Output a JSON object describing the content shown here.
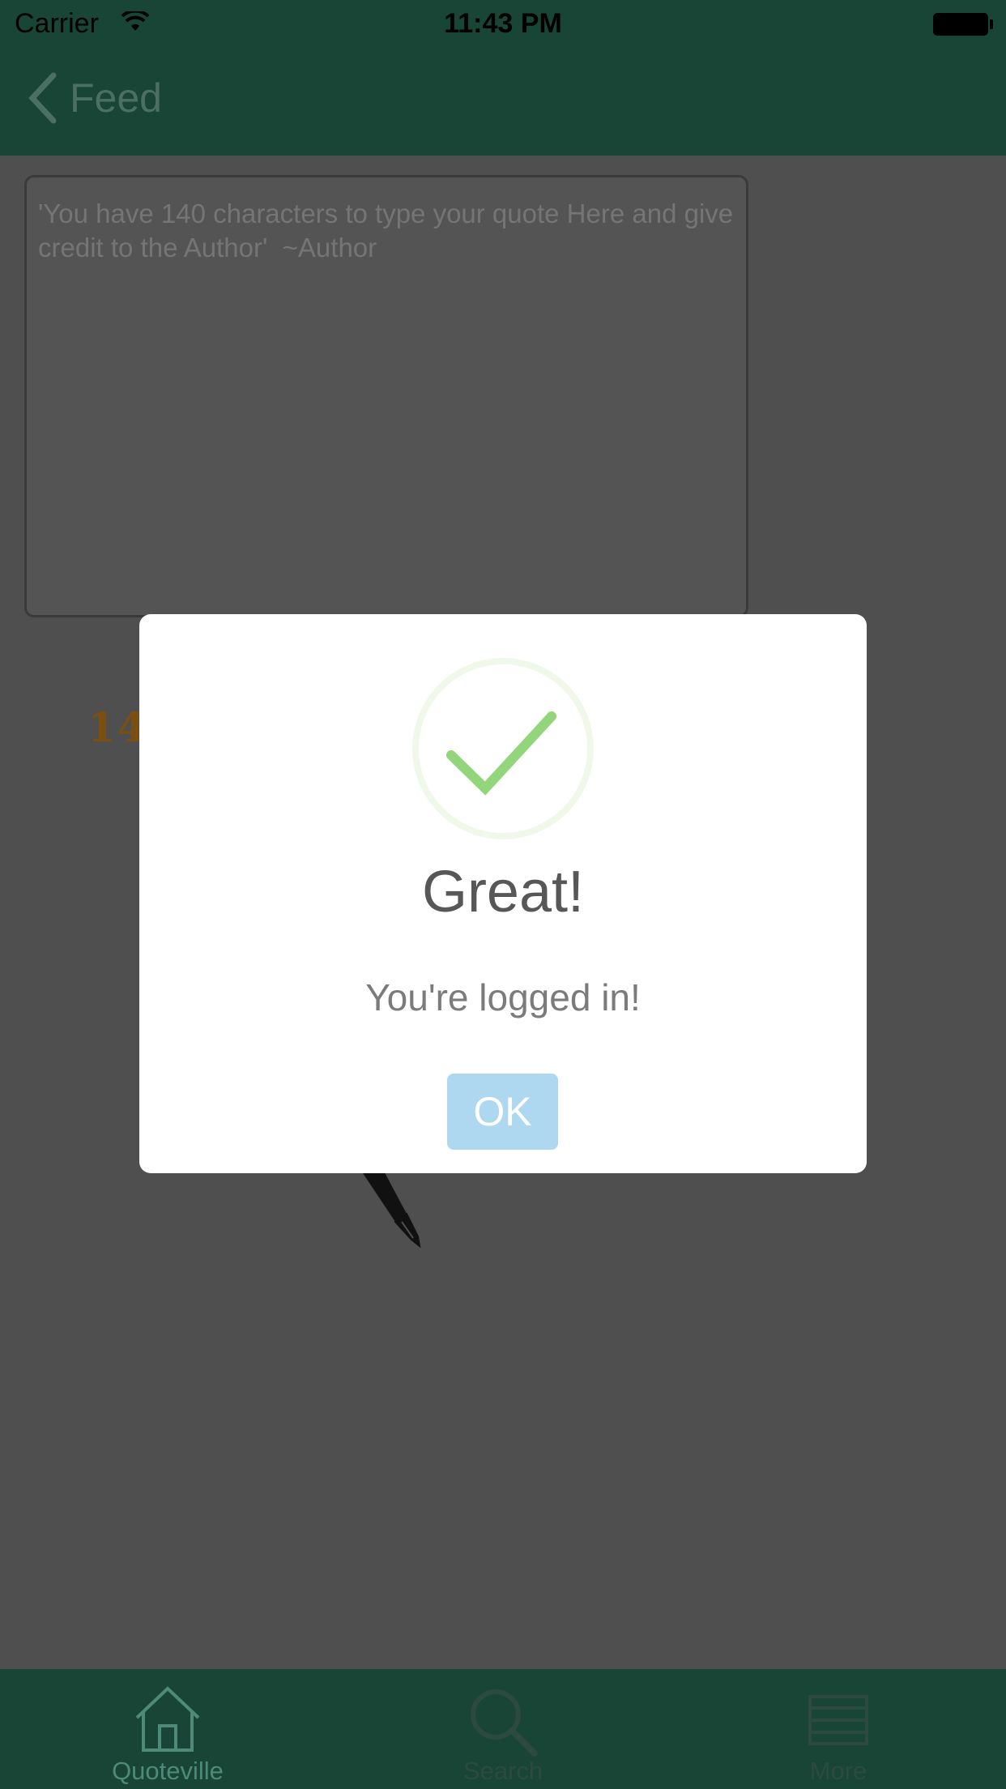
{
  "status_bar": {
    "carrier": "Carrier",
    "time": "11:43 PM"
  },
  "nav": {
    "back_label": "Feed"
  },
  "editor": {
    "placeholder": "'You have 140 characters to type your quote Here and give credit to the Author'  ~Author",
    "counter": "14"
  },
  "tabs": [
    {
      "label": "Quoteville",
      "icon": "home-icon"
    },
    {
      "label": "Search",
      "icon": "search-icon"
    },
    {
      "label": "More",
      "icon": "menu-icon"
    }
  ],
  "alert": {
    "title": "Great!",
    "message": "You're logged in!",
    "ok_label": "OK",
    "icon": "checkmark-icon"
  },
  "colors": {
    "header_green": "#184536",
    "check_green": "#93d57a",
    "ok_button": "#add8ef",
    "counter": "#7a4f0f"
  }
}
